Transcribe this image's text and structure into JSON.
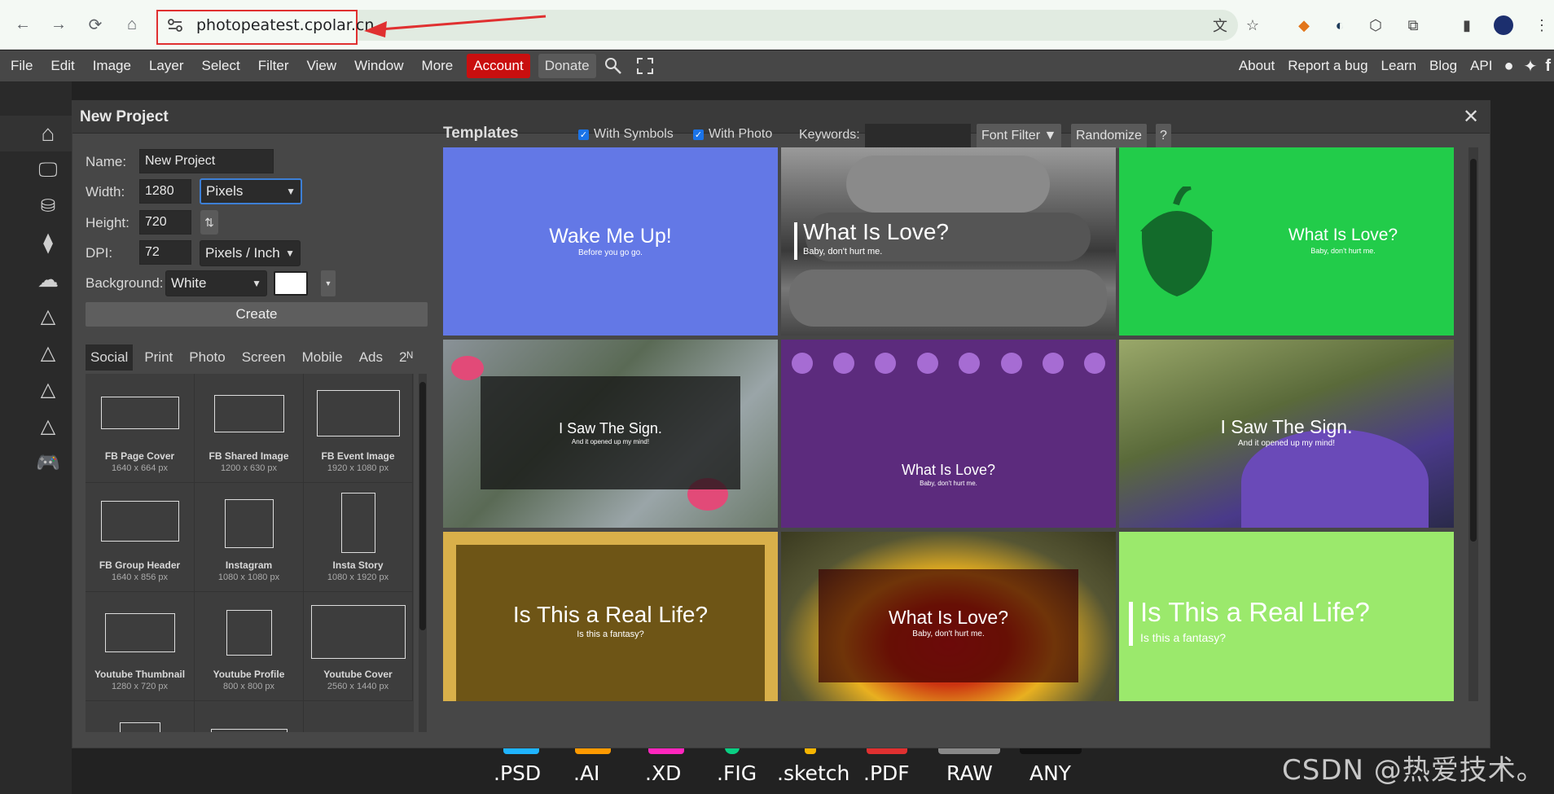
{
  "browser": {
    "url": "photopeatest.cpolar.cn"
  },
  "menubar": {
    "left": [
      "File",
      "Edit",
      "Image",
      "Layer",
      "Select",
      "Filter",
      "View",
      "Window",
      "More"
    ],
    "account": "Account",
    "donate": "Donate",
    "right": [
      "About",
      "Report a bug",
      "Learn",
      "Blog",
      "API"
    ]
  },
  "formats": [
    ".PSD",
    ".AI",
    ".XD",
    ".FIG",
    ".sketch",
    ".PDF",
    "RAW",
    "ANY"
  ],
  "watermark": "CSDN @热爱技术。",
  "dialog": {
    "title": "New Project",
    "name_label": "Name:",
    "name_value": "New Project",
    "width_label": "Width:",
    "width_value": "1280",
    "width_unit": "Pixels",
    "height_label": "Height:",
    "height_value": "720",
    "dpi_label": "DPI:",
    "dpi_value": "72",
    "dpi_unit": "Pixels / Inch",
    "background_label": "Background:",
    "background_value": "White",
    "background_color": "#ffffff",
    "create": "Create",
    "tabs": [
      "Social",
      "Print",
      "Photo",
      "Screen",
      "Mobile",
      "Ads",
      "2ᴺ"
    ],
    "presets": [
      {
        "name": "FB Page Cover",
        "size": "1640 x 664 px"
      },
      {
        "name": "FB Shared Image",
        "size": "1200 x 630 px"
      },
      {
        "name": "FB Event Image",
        "size": "1920 x 1080 px"
      },
      {
        "name": "FB Group Header",
        "size": "1640 x 856 px"
      },
      {
        "name": "Instagram",
        "size": "1080 x 1080 px"
      },
      {
        "name": "Insta Story",
        "size": "1080 x 1920 px"
      },
      {
        "name": "Youtube Thumbnail",
        "size": "1280 x 720 px"
      },
      {
        "name": "Youtube Profile",
        "size": "800 x 800 px"
      },
      {
        "name": "Youtube Cover",
        "size": "2560 x 1440 px"
      }
    ],
    "templates_title": "Templates",
    "with_symbols": "With Symbols",
    "with_photo": "With Photo",
    "keywords_label": "Keywords:",
    "font_filter": "Font Filter ▼",
    "randomize": "Randomize",
    "help": "?",
    "templates": [
      {
        "title": "Wake Me Up!",
        "sub": "Before you go go."
      },
      {
        "title": "What Is Love?",
        "sub": "Baby, don't hurt me."
      },
      {
        "title": "What Is Love?",
        "sub": "Baby, don't hurt me."
      },
      {
        "title": "I Saw The Sign.",
        "sub": "And it opened up my mind!"
      },
      {
        "title": "What Is Love?",
        "sub": "Baby, don't hurt me."
      },
      {
        "title": "I Saw The Sign.",
        "sub": "And it opened up my mind!"
      },
      {
        "title": "Is This a Real Life?",
        "sub": "Is this a fantasy?"
      },
      {
        "title": "What Is Love?",
        "sub": "Baby, don't hurt me."
      },
      {
        "title": "Is This a Real Life?",
        "sub": "Is this a fantasy?"
      }
    ]
  }
}
